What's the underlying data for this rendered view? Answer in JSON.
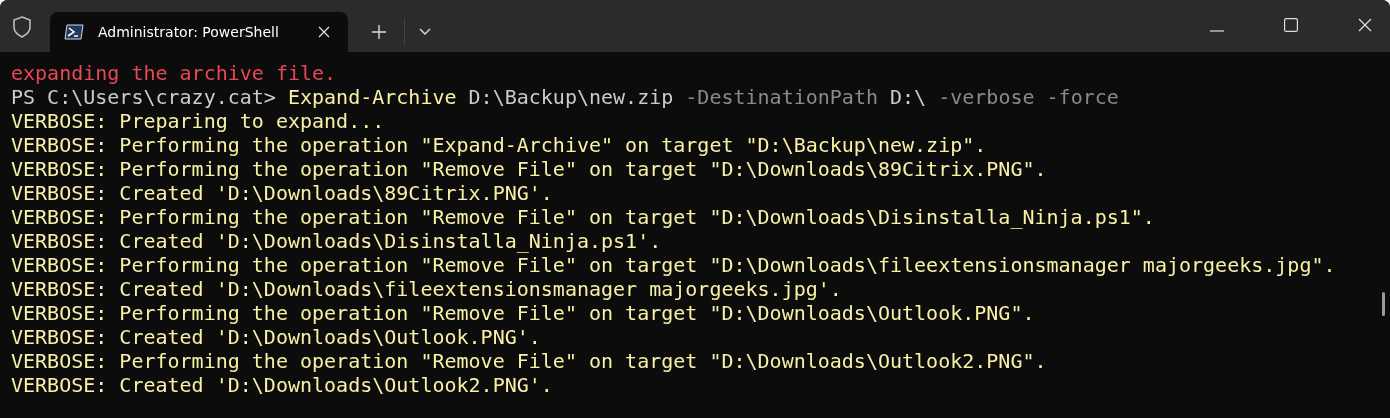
{
  "window": {
    "tab_title": "Administrator: PowerShell"
  },
  "console": [
    {
      "kind": "error",
      "text": "expanding the archive file."
    },
    {
      "kind": "command",
      "segments": [
        {
          "kind": "prompt",
          "text": "PS C:\\Users\\crazy.cat> "
        },
        {
          "kind": "cmdlet",
          "text": "Expand-Archive"
        },
        {
          "kind": "arg",
          "text": " D:\\Backup\\new.zip "
        },
        {
          "kind": "param",
          "text": "-DestinationPath"
        },
        {
          "kind": "arg",
          "text": " D:\\ "
        },
        {
          "kind": "param",
          "text": "-verbose -force"
        }
      ]
    },
    {
      "kind": "verbose",
      "text": "VERBOSE: Preparing to expand..."
    },
    {
      "kind": "verbose",
      "text": "VERBOSE: Performing the operation \"Expand-Archive\" on target \"D:\\Backup\\new.zip\"."
    },
    {
      "kind": "verbose",
      "text": "VERBOSE: Performing the operation \"Remove File\" on target \"D:\\Downloads\\89Citrix.PNG\"."
    },
    {
      "kind": "verbose",
      "text": "VERBOSE: Created 'D:\\Downloads\\89Citrix.PNG'."
    },
    {
      "kind": "verbose",
      "text": "VERBOSE: Performing the operation \"Remove File\" on target \"D:\\Downloads\\Disinstalla_Ninja.ps1\"."
    },
    {
      "kind": "verbose",
      "text": "VERBOSE: Created 'D:\\Downloads\\Disinstalla_Ninja.ps1'."
    },
    {
      "kind": "verbose",
      "text": "VERBOSE: Performing the operation \"Remove File\" on target \"D:\\Downloads\\fileextensionsmanager majorgeeks.jpg\"."
    },
    {
      "kind": "verbose",
      "text": "VERBOSE: Created 'D:\\Downloads\\fileextensionsmanager majorgeeks.jpg'."
    },
    {
      "kind": "verbose",
      "text": "VERBOSE: Performing the operation \"Remove File\" on target \"D:\\Downloads\\Outlook.PNG\"."
    },
    {
      "kind": "verbose",
      "text": "VERBOSE: Created 'D:\\Downloads\\Outlook.PNG'."
    },
    {
      "kind": "verbose",
      "text": "VERBOSE: Performing the operation \"Remove File\" on target \"D:\\Downloads\\Outlook2.PNG\"."
    },
    {
      "kind": "verbose",
      "text": "VERBOSE: Created 'D:\\Downloads\\Outlook2.PNG'."
    }
  ]
}
